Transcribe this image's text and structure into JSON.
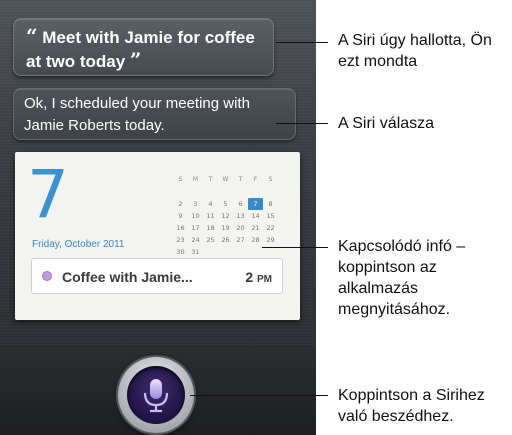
{
  "siri": {
    "heard_text": "Meet with Jamie for coffee at two today",
    "open_quote": "“",
    "close_quote": "”",
    "reply_text": "Ok, I scheduled your meeting with Jamie Roberts today."
  },
  "calendar_card": {
    "day": "7",
    "date_label": "Friday, October 2011",
    "weekday_headers": [
      "S",
      "M",
      "T",
      "W",
      "T",
      "F",
      "S"
    ],
    "weeks": [
      [
        "",
        "",
        "",
        "",
        "",
        "",
        ""
      ],
      [
        "2",
        "3",
        "4",
        "5",
        "6",
        "7",
        "8"
      ],
      [
        "9",
        "10",
        "11",
        "12",
        "13",
        "14",
        "15"
      ],
      [
        "16",
        "17",
        "18",
        "19",
        "20",
        "21",
        "22"
      ],
      [
        "23",
        "24",
        "25",
        "26",
        "27",
        "28",
        "29"
      ],
      [
        "30",
        "31",
        "",
        "",
        "",
        "",
        ""
      ]
    ],
    "selected_day": "7",
    "accent_color": "#3a8ac4",
    "event": {
      "title": "Coffee with Jamie...",
      "time": "2",
      "time_suffix": "PM",
      "dot_color": "#c79ad9"
    }
  },
  "mic_button": {
    "icon": "microphone-icon"
  },
  "callouts": {
    "heard": "A Siri úgy hallotta, Ön ezt mondta",
    "answer": "A Siri válasza",
    "info": "Kapcsolódó infó – koppintson az alkalmazás megnyitásához.",
    "mic": "Koppintson a Sirihez való beszédhez."
  }
}
